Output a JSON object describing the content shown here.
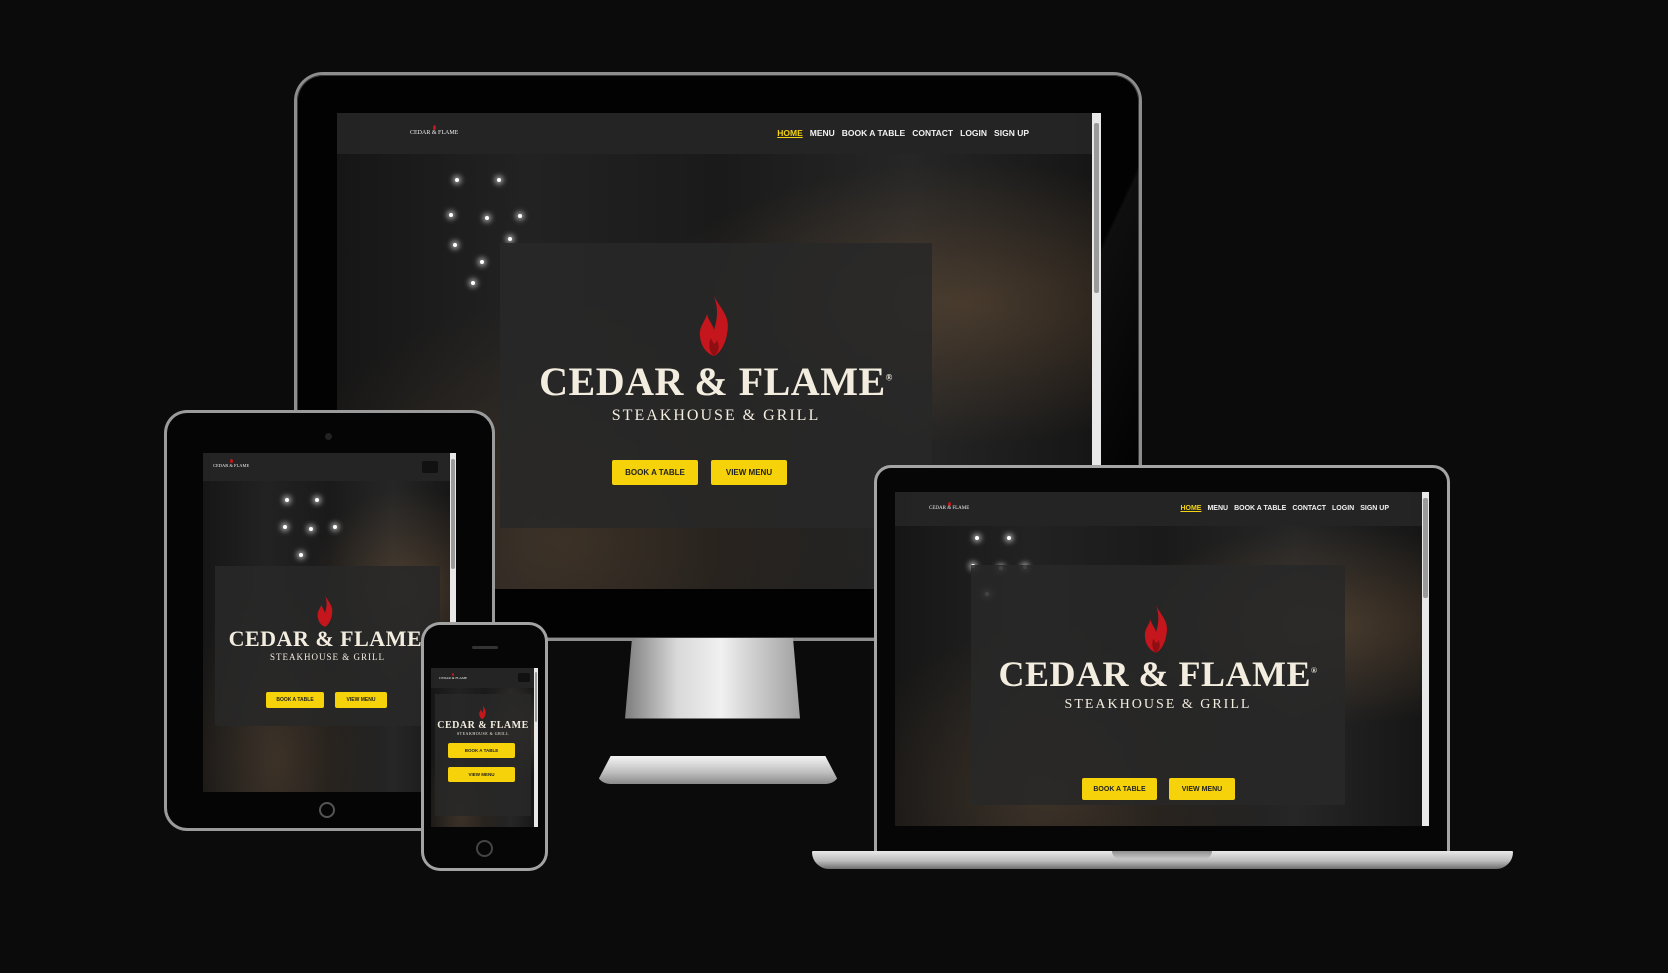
{
  "site": {
    "nav_links": [
      "HOME",
      "MENU",
      "BOOK A TABLE",
      "CONTACT",
      "LOGIN",
      "SIGN UP"
    ],
    "brand_title": "CEDAR & FLAME",
    "brand_registered": "®",
    "brand_subtitle": "STEAKHOUSE & GRILL",
    "book_button": "BOOK A TABLE",
    "menu_button": "VIEW MENU",
    "active_link": "HOME"
  },
  "colors": {
    "accent_yellow": "#f5d20a",
    "flame_red": "#c4161c",
    "nav_background": "#242424",
    "page_background": "#0c0b0c"
  },
  "icons": [
    "flame-icon",
    "hamburger-menu-icon",
    "home-button-icon",
    "camera-icon"
  ]
}
